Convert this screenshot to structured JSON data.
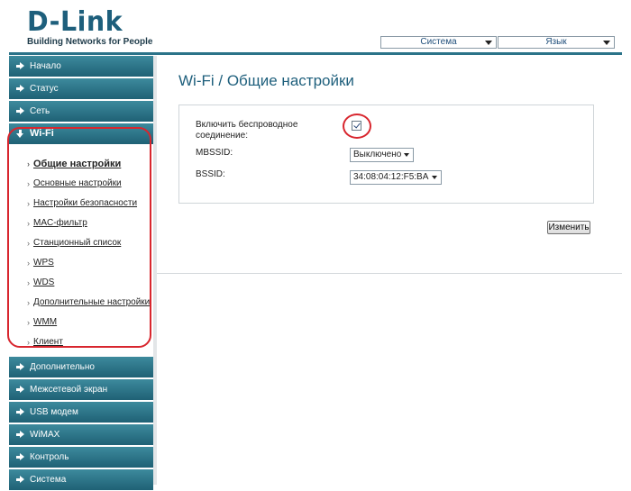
{
  "brand": {
    "logo_text": "D-Link",
    "tagline": "Building Networks for People"
  },
  "top_menu": {
    "system_label": "Система",
    "language_label": "Язык"
  },
  "sidebar": {
    "items": [
      {
        "label": "Начало"
      },
      {
        "label": "Статус"
      },
      {
        "label": "Сеть"
      },
      {
        "label": "Wi-Fi"
      },
      {
        "label": "Дополнительно"
      },
      {
        "label": "Межсетевой экран"
      },
      {
        "label": "USB модем"
      },
      {
        "label": "WiMAX"
      },
      {
        "label": "Контроль"
      },
      {
        "label": "Система"
      }
    ],
    "wifi_submenu": [
      {
        "label": "Общие настройки"
      },
      {
        "label": "Основные настройки"
      },
      {
        "label": "Настройки безопасности"
      },
      {
        "label": "MAC-фильтр"
      },
      {
        "label": "Станционный список"
      },
      {
        "label": "WPS"
      },
      {
        "label": "WDS"
      },
      {
        "label": "Дополнительные настройки"
      },
      {
        "label": "WMM"
      },
      {
        "label": "Клиент"
      }
    ]
  },
  "main": {
    "title": "Wi-Fi /  Общие настройки",
    "form": {
      "wireless_label": "Включить беспроводное соединение:",
      "wireless_checked": true,
      "mbssid_label": "MBSSID:",
      "mbssid_value": "Выключено",
      "bssid_label": "BSSID:",
      "bssid_value": "34:08:04:12:F5:BA"
    },
    "change_button": "Изменить"
  },
  "colors": {
    "brand_blue": "#1e5f7c",
    "sidebar_teal": "#2b7389",
    "annotation_red": "#d8262e"
  }
}
